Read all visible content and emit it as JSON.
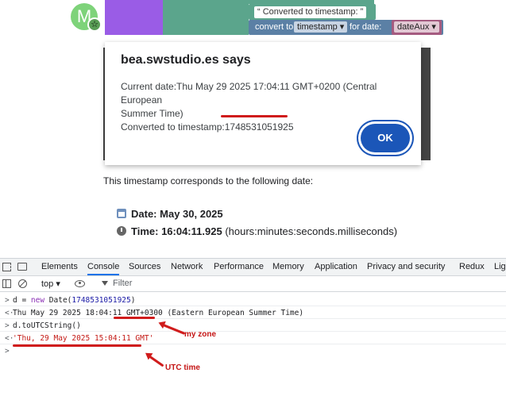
{
  "blocks": {
    "avatar_letter": "M",
    "string_block": "Converted to timestamp:",
    "convert_to_label": "convert to",
    "dropdown_value": "timestamp",
    "for_date_label": "for date:",
    "variable_value": "dateAux"
  },
  "alert": {
    "title": "bea.swstudio.es says",
    "line1": "Current date:Thu May 29 2025 17:04:11 GMT+0200 (Central European",
    "line2": "Summer Time)",
    "line3_prefix": "Converted to timestamp:",
    "line3_value": "1748531051925",
    "ok_label": "OK"
  },
  "article": {
    "intro": "This timestamp corresponds to the following date:",
    "date_label": "Date:",
    "date_value": "May 30, 2025",
    "time_label": "Time:",
    "time_value": "16:04:11.925",
    "time_note": "(hours:minutes:seconds.milliseconds)"
  },
  "devtools": {
    "tabs": [
      "Elements",
      "Console",
      "Sources",
      "Network",
      "Performance",
      "Memory",
      "Application",
      "Privacy and security",
      "Redux",
      "Lig"
    ],
    "active_tab": "Console",
    "context": "top ▾",
    "filter_placeholder": "Filter",
    "console": {
      "line1_prefix": ">",
      "line1_a": "d = ",
      "line1_kw": "new",
      "line1_b": " Date(",
      "line1_num": "1748531051925",
      "line1_c": ")",
      "line2_prefix": "<·",
      "line2_a": "Thu May 29 2025 18:04:11 ",
      "line2_zone": "GMT+0300",
      "line2_b": " (Eastern European Summer Time)",
      "line3_prefix": ">",
      "line3": "d.toUTCString()",
      "line4_prefix": "<·",
      "line4": "'Thu, 29 May 2025 15:04:11 GMT'",
      "line5_prefix": ">"
    }
  },
  "annotations": {
    "my_zone": "my zone",
    "utc_time": "UTC time",
    "color": "#d01c1c"
  }
}
